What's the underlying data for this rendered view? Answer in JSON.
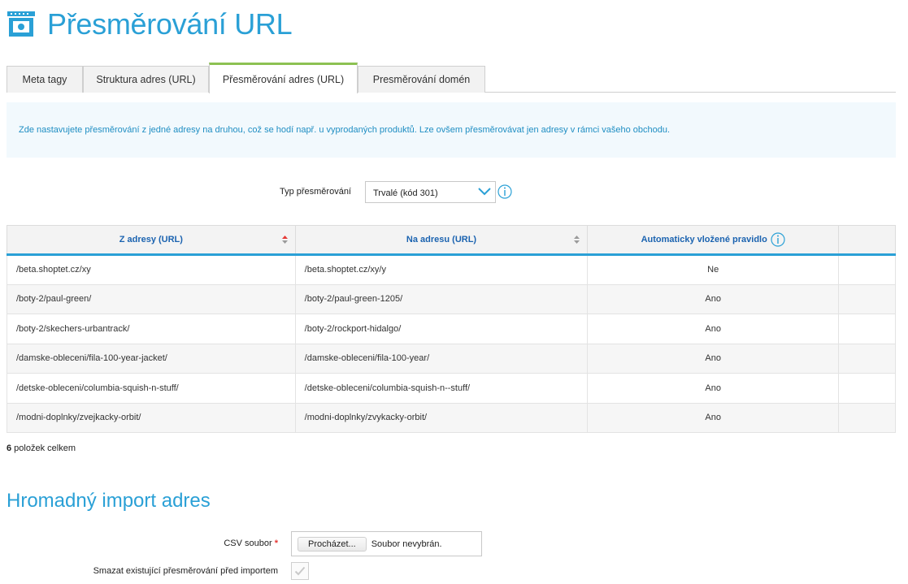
{
  "header": {
    "title": "Přesměrování URL",
    "icon": "shop-seo-icon"
  },
  "tabs": [
    {
      "label": "Meta tagy",
      "active": false
    },
    {
      "label": "Struktura adres (URL)",
      "active": false
    },
    {
      "label": "Přesměrování adres (URL)",
      "active": true
    },
    {
      "label": "Presměrování domén",
      "active": false
    }
  ],
  "info": {
    "text": "Zde nastavujete přesměrování z jedné adresy na druhou, což se hodí např. u vyprodaných produktů. Lze ovšem přesměrovávat jen adresy v rámci vašeho obchodu."
  },
  "redirect_type": {
    "label": "Typ přesměrování",
    "selected": "Trvalé (kód 301)"
  },
  "table": {
    "columns": [
      "Z adresy (URL)",
      "Na adresu (URL)",
      "Automaticky vložené pravidlo",
      ""
    ],
    "rows": [
      {
        "from": "/beta.shoptet.cz/xy",
        "to": "/beta.shoptet.cz/xy/y",
        "auto": "Ne"
      },
      {
        "from": "/boty-2/paul-green/",
        "to": "/boty-2/paul-green-1205/",
        "auto": "Ano"
      },
      {
        "from": "/boty-2/skechers-urbantrack/",
        "to": "/boty-2/rockport-hidalgo/",
        "auto": "Ano"
      },
      {
        "from": "/damske-obleceni/fila-100-year-jacket/",
        "to": "/damske-obleceni/fila-100-year/",
        "auto": "Ano"
      },
      {
        "from": "/detske-obleceni/columbia-squish-n-stuff/",
        "to": "/detske-obleceni/columbia-squish-n--stuff/",
        "auto": "Ano"
      },
      {
        "from": "/modni-doplnky/zvejkacky-orbit/",
        "to": "/modni-doplnky/zvykacky-orbit/",
        "auto": "Ano"
      }
    ]
  },
  "total": {
    "count": "6",
    "label": " položek celkem"
  },
  "import": {
    "title": "Hromadný import adres",
    "csv_label": "CSV soubor",
    "required_mark": "*",
    "browse_label": "Procházet...",
    "file_status": "Soubor nevybrán.",
    "delete_label": "Smazat existující přesměrování před importem",
    "delete_checked": false
  },
  "colors": {
    "accent": "#2aa0d6",
    "tab_active": "#8cc152",
    "header_text": "#1b63b0",
    "required": "#e53935"
  }
}
